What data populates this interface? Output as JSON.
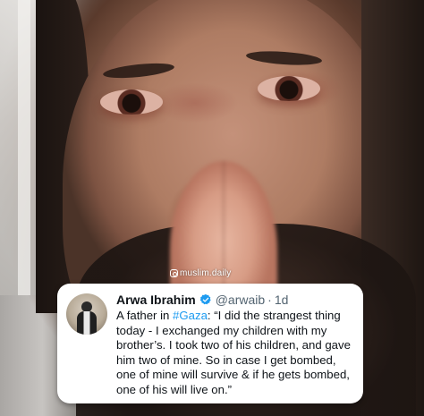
{
  "watermark": {
    "text": "muslim.daily",
    "icon": "instagram-icon"
  },
  "tweet": {
    "author_name": "Arwa Ibrahim",
    "verified_icon": "verified-badge-icon",
    "verified_color": "#1d9bf0",
    "handle": "@arwaib",
    "separator": "·",
    "time": "1d",
    "text_prefix": "A father in ",
    "hashtag": "#Gaza",
    "text_body": ": “I did the strangest thing today - I exchanged my children with my brother’s. I took two of his children, and gave him two of mine. So in case I get bombed, one of mine will survive & if he gets bombed, one of his will live on.”",
    "hashtag_color": "#1d9bf0"
  }
}
